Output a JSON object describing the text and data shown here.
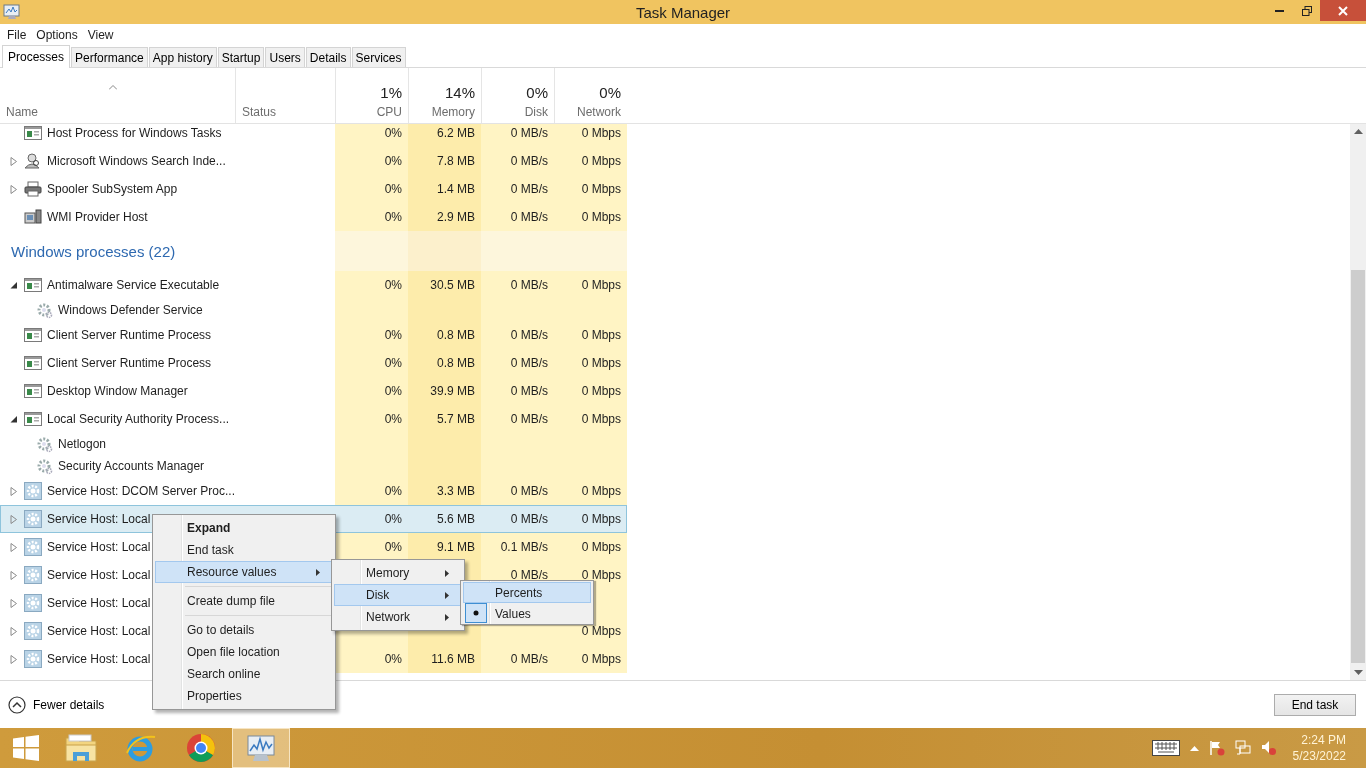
{
  "window": {
    "title": "Task Manager"
  },
  "menu_bar": [
    "File",
    "Options",
    "View"
  ],
  "tabs": [
    {
      "label": "Processes",
      "selected": true
    },
    {
      "label": "Performance",
      "selected": false
    },
    {
      "label": "App history",
      "selected": false
    },
    {
      "label": "Startup",
      "selected": false
    },
    {
      "label": "Users",
      "selected": false
    },
    {
      "label": "Details",
      "selected": false
    },
    {
      "label": "Services",
      "selected": false
    }
  ],
  "columns": [
    {
      "label": "Name",
      "sorted": true
    },
    {
      "label": "Status",
      "sorted": false
    },
    {
      "label": "CPU",
      "total": "1%",
      "sorted": false
    },
    {
      "label": "Memory",
      "total": "14%",
      "sorted": false
    },
    {
      "label": "Disk",
      "total": "0%",
      "sorted": false
    },
    {
      "label": "Network",
      "total": "0%",
      "sorted": false
    }
  ],
  "rows": [
    {
      "kind": "window",
      "name": "Host Process for Windows Tasks",
      "selected": false,
      "cpu": "0%",
      "memory": "6.2 MB",
      "disk": "0 MB/s",
      "network": "0 Mbps"
    },
    {
      "kind": "search",
      "name": "Microsoft Windows Search Inde...",
      "expanded": false,
      "selected": false,
      "cpu": "0%",
      "memory": "7.8 MB",
      "disk": "0 MB/s",
      "network": "0 Mbps"
    },
    {
      "kind": "printer",
      "name": "Spooler SubSystem App",
      "expanded": false,
      "selected": false,
      "cpu": "0%",
      "memory": "1.4 MB",
      "disk": "0 MB/s",
      "network": "0 Mbps"
    },
    {
      "kind": "wmi",
      "name": "WMI Provider Host",
      "selected": false,
      "cpu": "0%",
      "memory": "2.9 MB",
      "disk": "0 MB/s",
      "network": "0 Mbps"
    },
    {
      "kind": "group",
      "name": "Windows processes (22)"
    },
    {
      "kind": "window",
      "name": "Antimalware Service Executable",
      "expanded": true,
      "selected": false,
      "cpu": "0%",
      "memory": "30.5 MB",
      "disk": "0 MB/s",
      "network": "0 Mbps",
      "children": [
        {
          "name": "Windows Defender Service"
        }
      ]
    },
    {
      "kind": "window",
      "name": "Client Server Runtime Process",
      "selected": false,
      "cpu": "0%",
      "memory": "0.8 MB",
      "disk": "0 MB/s",
      "network": "0 Mbps"
    },
    {
      "kind": "window",
      "name": "Client Server Runtime Process",
      "selected": false,
      "cpu": "0%",
      "memory": "0.8 MB",
      "disk": "0 MB/s",
      "network": "0 Mbps"
    },
    {
      "kind": "window",
      "name": "Desktop Window Manager",
      "selected": false,
      "cpu": "0%",
      "memory": "39.9 MB",
      "disk": "0 MB/s",
      "network": "0 Mbps"
    },
    {
      "kind": "window",
      "name": "Local Security Authority Process...",
      "expanded": true,
      "selected": false,
      "cpu": "0%",
      "memory": "5.7 MB",
      "disk": "0 MB/s",
      "network": "0 Mbps",
      "children": [
        {
          "name": "Netlogon"
        },
        {
          "name": "Security Accounts Manager"
        }
      ]
    },
    {
      "kind": "service",
      "name": "Service Host: DCOM Server Proc...",
      "expanded": false,
      "selected": false,
      "cpu": "0%",
      "memory": "3.3 MB",
      "disk": "0 MB/s",
      "network": "0 Mbps"
    },
    {
      "kind": "service",
      "name": "Service Host: Local",
      "expanded": false,
      "selected": true,
      "cpu": "0%",
      "memory": "5.6 MB",
      "disk": "0 MB/s",
      "network": "0 Mbps"
    },
    {
      "kind": "service",
      "name": "Service Host: Local",
      "expanded": false,
      "selected": false,
      "cpu": "0%",
      "memory": "9.1 MB",
      "disk": "0.1 MB/s",
      "network": "0 Mbps"
    },
    {
      "kind": "service",
      "name": "Service Host: Local",
      "expanded": false,
      "selected": false,
      "disk": "0 MB/s",
      "network": "0 Mbps"
    },
    {
      "kind": "service",
      "name": "Service Host: Local",
      "expanded": false,
      "selected": false
    },
    {
      "kind": "service",
      "name": "Service Host: Local",
      "expanded": false,
      "selected": false,
      "network": "0 Mbps"
    },
    {
      "kind": "service",
      "name": "Service Host: Local",
      "expanded": false,
      "selected": false,
      "cpu": "0%",
      "memory": "11.6 MB",
      "disk": "0 MB/s",
      "network": "0 Mbps"
    }
  ],
  "context_menu": {
    "items": [
      {
        "kind": "item",
        "label": "Expand",
        "default": true,
        "selected": false,
        "submenu": false
      },
      {
        "kind": "item",
        "label": "End task",
        "default": false,
        "selected": false,
        "submenu": false
      },
      {
        "kind": "item",
        "label": "Resource values",
        "default": false,
        "selected": true,
        "submenu": true
      },
      {
        "kind": "separator"
      },
      {
        "kind": "item",
        "label": "Create dump file",
        "default": false,
        "selected": false,
        "submenu": false
      },
      {
        "kind": "separator"
      },
      {
        "kind": "item",
        "label": "Go to details",
        "default": false,
        "selected": false,
        "submenu": false
      },
      {
        "kind": "item",
        "label": "Open file location",
        "default": false,
        "selected": false,
        "submenu": false
      },
      {
        "kind": "item",
        "label": "Search online",
        "default": false,
        "selected": false,
        "submenu": false
      },
      {
        "kind": "item",
        "label": "Properties",
        "default": false,
        "selected": false,
        "submenu": false
      }
    ]
  },
  "resource_submenu": {
    "items": [
      {
        "label": "Memory",
        "selected": false
      },
      {
        "label": "Disk",
        "selected": true
      },
      {
        "label": "Network",
        "selected": false
      }
    ]
  },
  "disk_submenu": {
    "items": [
      {
        "label": "Percents",
        "selected": true,
        "checked": false
      },
      {
        "label": "Values",
        "selected": false,
        "checked": true
      }
    ]
  },
  "footer": {
    "fewer_details": "Fewer details",
    "end_task": "End task"
  },
  "taskbar": {
    "apps": [
      {
        "kind": "start",
        "active": false
      },
      {
        "kind": "explorer",
        "active": false
      },
      {
        "kind": "ie",
        "active": false
      },
      {
        "kind": "chrome",
        "active": false
      },
      {
        "kind": "taskmanager",
        "active": true
      }
    ],
    "clock": {
      "time": "2:24 PM",
      "date": "5/23/2022"
    }
  }
}
